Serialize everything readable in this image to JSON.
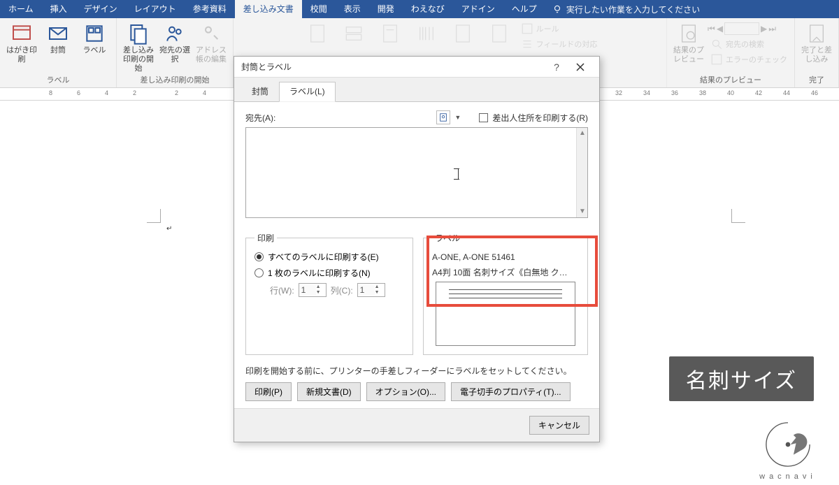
{
  "tabs": {
    "home": "ホーム",
    "insert": "挿入",
    "design": "デザイン",
    "layout": "レイアウト",
    "references": "参考資料",
    "mailings": "差し込み文書",
    "review": "校閲",
    "view": "表示",
    "developer": "開発",
    "custom": "わえなび",
    "addin": "アドイン",
    "help": "ヘルプ",
    "tellme": "実行したい作業を入力してください"
  },
  "ribbon": {
    "create": {
      "label": "ラベル",
      "hagaki": "はがき印刷",
      "envelope": "封筒"
    },
    "start": {
      "label": "差し込み印刷の開始",
      "start_btn": "差し込み印刷の開始",
      "select": "宛先の選択",
      "edit": "アドレス帳の編集"
    },
    "fields": {
      "rules": "ルール",
      "match": "フィールドの対応",
      "update": ""
    },
    "preview": {
      "label": "結果のプレビュー",
      "first": "|◀",
      "prev": "◀",
      "page": "",
      "next": "▶",
      "last": "▶|",
      "btn": "結果のプレビュー",
      "find": "宛先の検索",
      "check": "エラーのチェック"
    },
    "finish": {
      "label": "完了",
      "btn": "完了と差し込み"
    }
  },
  "dialog": {
    "title": "封筒とラベル",
    "help": "?",
    "tabs": {
      "envelope": "封筒",
      "label": "ラベル(L)"
    },
    "addr_label": "宛先(A):",
    "sender_ck": "差出人住所を印刷する(R)",
    "addr_value": "",
    "print_group": "印刷",
    "label_group": "ラベル",
    "radio_all": "すべてのラベルに印刷する(E)",
    "radio_one": "1 枚のラベルに印刷する(N)",
    "row_lbl": "行(W):",
    "row_val": "1",
    "col_lbl": "列(C):",
    "col_val": "1",
    "label_info1": "A-ONE, A-ONE 51461",
    "label_info2": "A4判 10面 名刺サイズ《白無地 ク…",
    "hint": "印刷を開始する前に、プリンターの手差しフィーダーにラベルをセットしてください。",
    "btn_print": "印刷(P)",
    "btn_newdoc": "新規文書(D)",
    "btn_options": "オプション(O)...",
    "btn_eprops": "電子切手のプロパティ(T)...",
    "btn_cancel": "キャンセル"
  },
  "callout": "名刺サイズ",
  "logo_text": "wacnavi"
}
